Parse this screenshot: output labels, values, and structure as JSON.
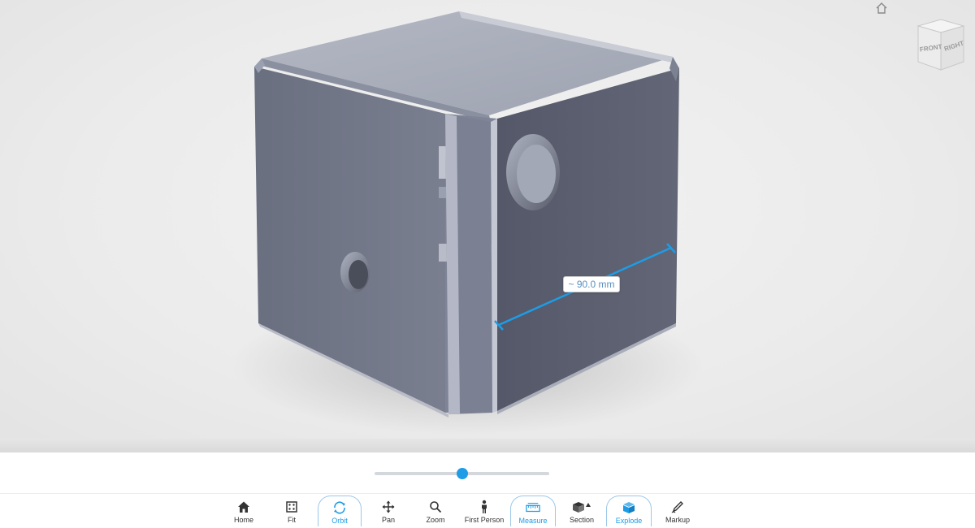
{
  "viewer": {
    "measurement_label": "~ 90.0 mm",
    "viewcube": {
      "front_label": "FRONT",
      "right_label": "RIGHT",
      "icon": "viewcube"
    },
    "home_view_icon": "home-outline-icon"
  },
  "explode_slider": {
    "value_fraction": 0.5
  },
  "toolbar": {
    "home": {
      "label": "Home",
      "icon": "home-icon"
    },
    "fit": {
      "label": "Fit",
      "icon": "fit-icon"
    },
    "orbit": {
      "label": "Orbit",
      "icon": "orbit-icon",
      "active": true
    },
    "pan": {
      "label": "Pan",
      "icon": "pan-icon"
    },
    "zoom": {
      "label": "Zoom",
      "icon": "zoom-icon"
    },
    "first_person": {
      "label": "First Person",
      "icon": "person-icon"
    },
    "measure": {
      "label": "Measure",
      "icon": "measure-icon",
      "active": true
    },
    "section": {
      "label": "Section",
      "icon": "section-icon"
    },
    "explode": {
      "label": "Explode",
      "icon": "explode-icon",
      "active": true
    },
    "markup": {
      "label": "Markup",
      "icon": "markup-icon"
    }
  },
  "colors": {
    "accent": "#1e9ce6",
    "model_face_left": "#6f7486",
    "model_face_right": "#5b5f6e",
    "model_top": "#a7acb9"
  }
}
